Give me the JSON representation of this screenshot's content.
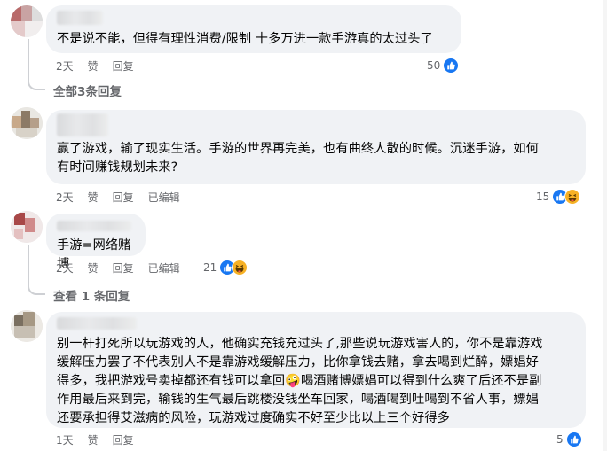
{
  "comments": [
    {
      "text": "不是说不能，但得有理性消费/限制 十多万进一款手游真的太过头了",
      "time": "2天",
      "like_label": "赞",
      "reply_label": "回复",
      "edited_label": "",
      "reaction_count": "50",
      "reactions": [
        "like-icon"
      ],
      "view_replies": "全部3条回复"
    },
    {
      "text": "赢了游戏，输了现实生活。手游的世界再完美，也有曲终人散的时候。沉迷手游，如何\n有时间赚钱规划未来?",
      "time": "2天",
      "like_label": "赞",
      "reply_label": "回复",
      "edited_label": "已编辑",
      "reaction_count": "15",
      "reactions": [
        "like-icon",
        "haha-icon"
      ],
      "view_replies": ""
    },
    {
      "text": "手游=网络赌博",
      "time": "2天",
      "like_label": "赞",
      "reply_label": "回复",
      "edited_label": "已编辑",
      "reaction_count": "21",
      "reactions": [
        "like-icon",
        "haha-icon"
      ],
      "view_replies": "查看 1 条回复"
    },
    {
      "text": "别一杆打死所以玩游戏的人，他确实充钱充过头了,那些说玩游戏害人的，你不是靠游戏\n缓解压力罢了不代表别人不是靠游戏缓解压力，比你拿钱去赌，拿去喝到烂醉，嫖娼好\n得多，我把游戏号卖掉都还有钱可以拿回🤪喝酒赌博嫖娼可以得到什么爽了后还不是副\n作用最后来到完，输钱的生气最后跳楼没钱坐车回家，喝酒喝到吐喝到不省人事，嫖娼\n还要承担得艾滋病的风险，玩游戏过度确实不好至少比以上三个好得多",
      "time": "1天",
      "like_label": "赞",
      "reply_label": "回复",
      "edited_label": "",
      "reaction_count": "5",
      "reactions": [
        "like-icon"
      ],
      "view_replies": ""
    }
  ],
  "colors": {
    "bubble": "#f0f2f5",
    "meta_text": "#65676b",
    "like": "#1877f2",
    "haha": "#f7b125",
    "thread_line": "#ced0d4"
  }
}
